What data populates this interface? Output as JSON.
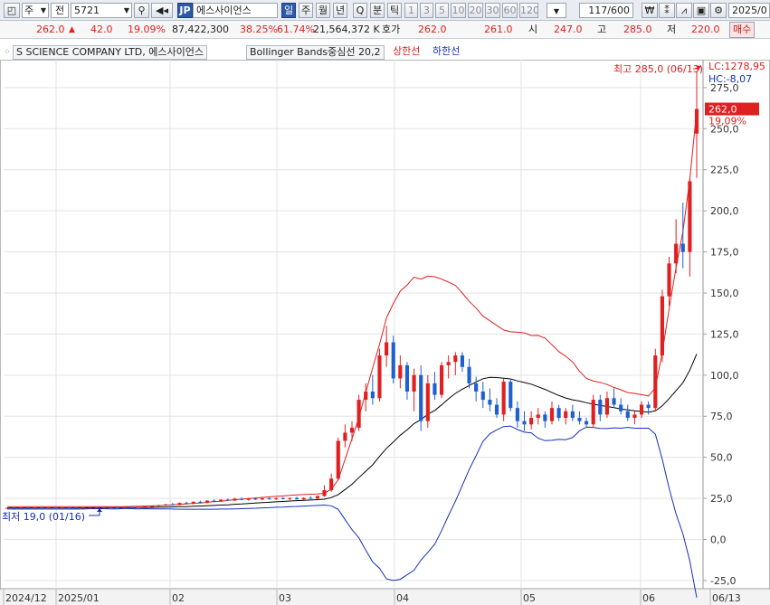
{
  "toolbar": {
    "type_select": "주",
    "type_select2": "전",
    "code": "5721",
    "market_badge": "JP",
    "name": "에스사이언스",
    "periods": [
      "일",
      "주",
      "월",
      "년",
      "Q",
      "분",
      "틱"
    ],
    "active_period": "일",
    "intervals": [
      "1",
      "3",
      "5",
      "10",
      "20",
      "30",
      "60",
      "120"
    ],
    "count": "117",
    "count_max": "/600",
    "date": "2025/0"
  },
  "quote": {
    "price": "262.0",
    "change_arrow": "▲",
    "change": "42.0",
    "change_rate": "19.09%",
    "volume": "87,422,300",
    "vol_rate": "38.25%",
    "turnover_rate": "61.74%",
    "amount": "21,564,372 K",
    "bid_label": "호가",
    "bid1": "262.0",
    "bid2": "261.0",
    "open_label": "시",
    "open": "247.0",
    "high_label": "고",
    "high": "285.0",
    "low_label": "저",
    "low": "220.0",
    "buy_label": "매수"
  },
  "legend": {
    "company": "S SCIENCE COMPANY LTD,  에스사이언스",
    "indicator": "Bollinger Bands중심선 20,2",
    "upper": "상한선",
    "lower": "하한선"
  },
  "annotations": {
    "lc": "LC:1278,95",
    "hc": "HC:-8,07",
    "max_label": "최고 285,0 (06/13)",
    "min_label": "최저 19,0 (01/16)",
    "current_price": "262,0",
    "current_rate": "19,09%"
  },
  "colors": {
    "up": "#e02020",
    "down": "#1f5fd0",
    "middle": "#000000",
    "upper_band": "#e02020",
    "lower_band": "#1530b8",
    "grid": "#e3e3e3"
  },
  "chart_data": {
    "type": "candlestick",
    "ylim": [
      -30,
      292
    ],
    "y_ticks": [
      "-25,0",
      "0,0",
      "25,0",
      "50,0",
      "75,0",
      "100,0",
      "125,0",
      "150,0",
      "175,0",
      "200,0",
      "225,0",
      "250,0",
      "275,0"
    ],
    "x_ticks": [
      "2024/12",
      "2025/01",
      "02",
      "03",
      "04",
      "05",
      "06",
      "06/13"
    ],
    "candles": [
      [
        19,
        19.4,
        18.9,
        19.2
      ],
      [
        19.2,
        19.5,
        18.9,
        19.1
      ],
      [
        19.1,
        19.4,
        18.8,
        19.3
      ],
      [
        19.3,
        19.6,
        19.0,
        19.2
      ],
      [
        19.2,
        19.5,
        18.9,
        19.4
      ],
      [
        19.4,
        19.7,
        19.0,
        19.2
      ],
      [
        19.2,
        19.6,
        18.9,
        19.5
      ],
      [
        19.5,
        19.8,
        19.1,
        19.3
      ],
      [
        19.3,
        19.6,
        19.0,
        19.4
      ],
      [
        19.4,
        19.7,
        19.1,
        19.2
      ],
      [
        19.2,
        19.4,
        19.0,
        19.1
      ],
      [
        19.1,
        19.3,
        19.0,
        19.2
      ],
      [
        19.2,
        19.5,
        19.0,
        19.3
      ],
      [
        19.3,
        19.5,
        19.0,
        19.4
      ],
      [
        19.4,
        19.7,
        19.1,
        19.5
      ],
      [
        19.5,
        19.8,
        19.2,
        19.6
      ],
      [
        19.6,
        19.9,
        19.3,
        19.5
      ],
      [
        19.5,
        19.8,
        19.2,
        19.7
      ],
      [
        19.7,
        20.0,
        19.4,
        19.6
      ],
      [
        19.6,
        19.9,
        19.3,
        19.8
      ],
      [
        19.8,
        20.3,
        19.5,
        20.1
      ],
      [
        20.1,
        20.6,
        19.8,
        20.4
      ],
      [
        20.4,
        21.0,
        20.0,
        20.8
      ],
      [
        20.8,
        21.6,
        20.5,
        21.3
      ],
      [
        21.3,
        22.2,
        20.9,
        21.0
      ],
      [
        21.0,
        22.5,
        20.8,
        22.2
      ],
      [
        22.2,
        23.0,
        21.5,
        21.7
      ],
      [
        21.7,
        23.2,
        21.4,
        22.9
      ],
      [
        22.9,
        23.6,
        22.0,
        22.3
      ],
      [
        22.3,
        24.0,
        22.0,
        23.6
      ],
      [
        23.6,
        24.4,
        22.8,
        23.1
      ],
      [
        23.1,
        24.6,
        22.8,
        24.2
      ],
      [
        24.2,
        25.0,
        23.4,
        23.7
      ],
      [
        23.7,
        25.2,
        23.4,
        24.8
      ],
      [
        24.8,
        25.5,
        23.8,
        24.1
      ],
      [
        24.1,
        25.3,
        23.6,
        24.9
      ],
      [
        24.9,
        25.6,
        24.0,
        24.3
      ],
      [
        24.3,
        25.4,
        23.9,
        25.0
      ],
      [
        25.0,
        25.8,
        24.2,
        24.5
      ],
      [
        24.5,
        25.4,
        24.0,
        25.1
      ],
      [
        25.1,
        25.9,
        24.3,
        24.6
      ],
      [
        24.6,
        25.5,
        24.0,
        25.2
      ],
      [
        25.2,
        26.0,
        24.2,
        24.4
      ],
      [
        24.4,
        25.6,
        24.0,
        25.3
      ],
      [
        25.3,
        26.4,
        25.0,
        24.9
      ],
      [
        24.9,
        26.8,
        24.6,
        26.4
      ],
      [
        26.4,
        33,
        26,
        30
      ],
      [
        30,
        40,
        29,
        37
      ],
      [
        37,
        62,
        36,
        60
      ],
      [
        60,
        70,
        56,
        65
      ],
      [
        65,
        72,
        60,
        68
      ],
      [
        68,
        88,
        66,
        85
      ],
      [
        85,
        95,
        78,
        90
      ],
      [
        90,
        100,
        82,
        86
      ],
      [
        86,
        116,
        84,
        112
      ],
      [
        112,
        130,
        105,
        120
      ],
      [
        120,
        124,
        95,
        98
      ],
      [
        98,
        112,
        92,
        106
      ],
      [
        106,
        108,
        85,
        90
      ],
      [
        90,
        104,
        78,
        100
      ],
      [
        100,
        106,
        66,
        72
      ],
      [
        72,
        100,
        68,
        95
      ],
      [
        95,
        102,
        85,
        88
      ],
      [
        88,
        108,
        86,
        106
      ],
      [
        106,
        112,
        98,
        108
      ],
      [
        108,
        114,
        100,
        112
      ],
      [
        112,
        114,
        102,
        105
      ],
      [
        105,
        110,
        92,
        95
      ],
      [
        95,
        99,
        84,
        90
      ],
      [
        90,
        96,
        80,
        85
      ],
      [
        85,
        92,
        78,
        82
      ],
      [
        82,
        86,
        74,
        76
      ],
      [
        76,
        98,
        72,
        96
      ],
      [
        96,
        98,
        78,
        80
      ],
      [
        80,
        84,
        68,
        72
      ],
      [
        72,
        78,
        66,
        70
      ],
      [
        70,
        78,
        67,
        74
      ],
      [
        74,
        80,
        70,
        76
      ],
      [
        76,
        78,
        68,
        72
      ],
      [
        72,
        84,
        70,
        80
      ],
      [
        80,
        82,
        72,
        74
      ],
      [
        74,
        80,
        70,
        78
      ],
      [
        78,
        82,
        72,
        74
      ],
      [
        74,
        78,
        70,
        72
      ],
      [
        72,
        74,
        68,
        70
      ],
      [
        70,
        88,
        68,
        85
      ],
      [
        85,
        88,
        72,
        76
      ],
      [
        76,
        90,
        74,
        86
      ],
      [
        86,
        92,
        80,
        82
      ],
      [
        82,
        86,
        76,
        78
      ],
      [
        78,
        82,
        72,
        74
      ],
      [
        74,
        78,
        70,
        76
      ],
      [
        76,
        84,
        74,
        82
      ],
      [
        82,
        84,
        76,
        80
      ],
      [
        80,
        116,
        78,
        112
      ],
      [
        112,
        152,
        108,
        148
      ],
      [
        148,
        172,
        142,
        168
      ],
      [
        168,
        195,
        162,
        180
      ],
      [
        180,
        205,
        165,
        175
      ],
      [
        175,
        220,
        160,
        218
      ],
      [
        247,
        285,
        220,
        262
      ]
    ],
    "series": [
      {
        "name": "Bollinger Bands중심선 20,2",
        "values": [
          19.2,
          19.2,
          19.2,
          19.2,
          19.2,
          19.2,
          19.2,
          19.2,
          19.2,
          19.2,
          19.2,
          19.2,
          19.3,
          19.3,
          19.3,
          19.3,
          19.3,
          19.4,
          19.4,
          19.4,
          19.5,
          19.5,
          19.6,
          19.7,
          19.8,
          19.9,
          20.0,
          20.2,
          20.3,
          20.5,
          20.7,
          20.9,
          21.1,
          21.4,
          21.6,
          21.9,
          22.1,
          22.4,
          22.6,
          22.9,
          23.1,
          23.4,
          23.6,
          23.8,
          24.0,
          24.2,
          24.5,
          25.5,
          27.3,
          30.4,
          33.6,
          37.6,
          41.5,
          45.4,
          50.6,
          55.4,
          59.3,
          63.4,
          66.7,
          70.5,
          72.9,
          76.2,
          78.5,
          81.9,
          85.6,
          88.9,
          91.4,
          93.7,
          95.9,
          97.8,
          98.7,
          98.5,
          98.1,
          97.7,
          96.5,
          95.5,
          94.5,
          92.9,
          91.3,
          89.4,
          87.6,
          86.1,
          85.0,
          84.2,
          83.2,
          82.3,
          81.6,
          80.9,
          80.2,
          79.4,
          78.8,
          78.3,
          77.9,
          77.5,
          78.2,
          81.3,
          85.7,
          90.5,
          95.4,
          103.1,
          112.9
        ]
      },
      {
        "name": "상한선",
        "values": [
          19.9,
          19.9,
          19.9,
          19.9,
          19.9,
          19.9,
          19.9,
          19.9,
          19.9,
          19.9,
          19.9,
          19.9,
          19.9,
          19.9,
          19.9,
          20.0,
          20.0,
          20.0,
          20.1,
          20.2,
          20.3,
          20.4,
          20.6,
          20.8,
          21.1,
          21.4,
          21.6,
          22.0,
          22.2,
          22.6,
          23.0,
          23.3,
          23.7,
          24.2,
          24.5,
          24.9,
          25.2,
          25.6,
          25.9,
          26.2,
          26.5,
          26.8,
          27.1,
          27.3,
          27.5,
          27.7,
          28.1,
          30.5,
          36.3,
          48.8,
          61.2,
          74.2,
          89.5,
          104.5,
          118.8,
          134.8,
          143.6,
          151.1,
          154.9,
          159.7,
          158.4,
          160.3,
          159.9,
          158.4,
          156.6,
          154.6,
          150.0,
          144.9,
          140.8,
          135.9,
          133.1,
          130.3,
          127.5,
          126.4,
          126.1,
          125.7,
          124.1,
          124.2,
          122.5,
          118.5,
          114.3,
          111.5,
          108.0,
          102.3,
          98.0,
          96.4,
          95.6,
          94.3,
          92.5,
          91.1,
          89.4,
          88.9,
          88.1,
          87.3,
          92.3,
          113.7,
          140.3,
          165.3,
          187.5,
          219.4,
          261.2
        ]
      },
      {
        "name": "하한선",
        "values": [
          18.5,
          18.5,
          18.5,
          18.5,
          18.5,
          18.5,
          18.5,
          18.5,
          18.5,
          18.5,
          18.5,
          18.5,
          18.7,
          18.7,
          18.7,
          18.6,
          18.6,
          18.8,
          18.7,
          18.6,
          18.7,
          18.6,
          18.6,
          18.6,
          18.5,
          18.4,
          18.4,
          18.4,
          18.4,
          18.4,
          18.4,
          18.5,
          18.5,
          18.6,
          18.7,
          18.9,
          19.0,
          19.2,
          19.3,
          19.6,
          19.7,
          20.0,
          20.1,
          20.3,
          20.5,
          20.7,
          20.9,
          20.5,
          18.3,
          12.0,
          6.0,
          1.0,
          -6.5,
          -13.7,
          -17.6,
          -24.0,
          -25.0,
          -24.3,
          -21.5,
          -18.7,
          -12.6,
          -7.9,
          -2.9,
          5.4,
          14.6,
          23.2,
          32.8,
          42.5,
          51.0,
          59.7,
          64.3,
          66.7,
          68.7,
          69.0,
          66.9,
          65.3,
          64.9,
          61.6,
          60.1,
          60.3,
          60.9,
          60.7,
          62.0,
          66.1,
          68.4,
          68.2,
          67.6,
          67.5,
          67.9,
          67.7,
          68.2,
          67.7,
          67.7,
          67.7,
          64.1,
          48.9,
          31.1,
          15.7,
          3.3,
          -13.2,
          -35.4
        ]
      }
    ]
  }
}
